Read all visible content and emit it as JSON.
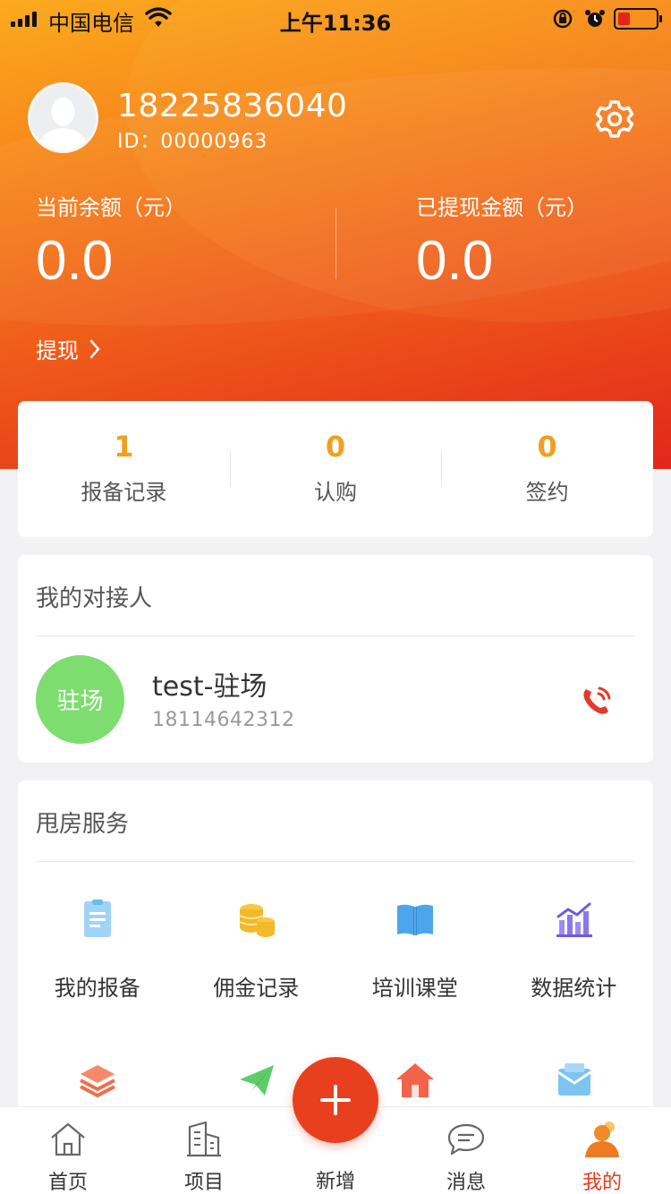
{
  "status_bar": {
    "carrier": "中国电信",
    "time": "上午11:36"
  },
  "profile": {
    "phone": "18225836040",
    "id_text": "ID：00000963"
  },
  "balance": {
    "current_label": "当前余额（元）",
    "current_value": "0.0",
    "withdrawn_label": "已提现金额（元）",
    "withdrawn_value": "0.0",
    "withdraw_link": "提现"
  },
  "stats": [
    {
      "value": "1",
      "label": "报备记录"
    },
    {
      "value": "0",
      "label": "认购"
    },
    {
      "value": "0",
      "label": "签约"
    }
  ],
  "contact": {
    "section_title": "我的对接人",
    "avatar_text": "驻场",
    "name": "test-驻场",
    "phone": "18114642312"
  },
  "services": {
    "section_title": "甩房服务",
    "items": [
      {
        "label": "我的报备",
        "icon": "report-doc-icon"
      },
      {
        "label": "佣金记录",
        "icon": "coins-icon"
      },
      {
        "label": "培训课堂",
        "icon": "book-icon"
      },
      {
        "label": "数据统计",
        "icon": "chart-icon"
      },
      {
        "label": "",
        "icon": "layers-icon"
      },
      {
        "label": "",
        "icon": "paper-plane-icon"
      },
      {
        "label": "",
        "icon": "house-icon"
      },
      {
        "label": "",
        "icon": "wallet-icon"
      }
    ]
  },
  "tabbar": {
    "tabs": [
      {
        "label": "首页",
        "icon": "home-icon"
      },
      {
        "label": "项目",
        "icon": "building-icon"
      },
      {
        "label": "新增",
        "icon": "plus-icon"
      },
      {
        "label": "消息",
        "icon": "message-icon"
      },
      {
        "label": "我的",
        "icon": "profile-icon"
      }
    ],
    "active": "我的"
  },
  "colors": {
    "accent": "#e8401f",
    "orange": "#f7861a",
    "stat_number": "#f0a020",
    "contact_avatar": "#7ddd6f"
  }
}
